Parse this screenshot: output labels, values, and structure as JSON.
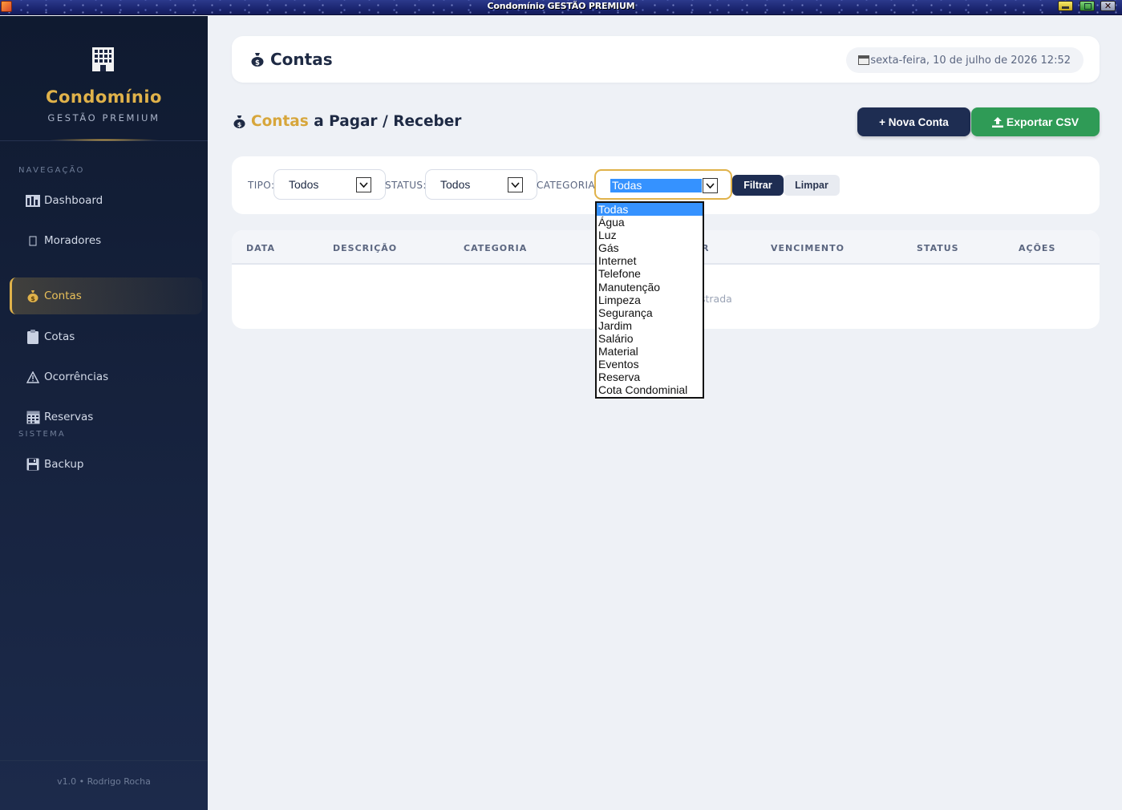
{
  "window": {
    "title": "Condomínio GESTÃO PREMIUM",
    "controls": [
      "minimize",
      "maximize",
      "close"
    ]
  },
  "sidebar": {
    "brand_name": "Condomínio",
    "brand_sub": "GESTÃO PREMIUM",
    "section_nav": "NAVEGAÇÃO",
    "section_system": "SISTEMA",
    "items": [
      {
        "label": "Dashboard",
        "icon": "chart-bars-icon"
      },
      {
        "label": "Moradores",
        "icon": "placeholder-box-icon"
      },
      {
        "label": "Contas",
        "icon": "money-bag-icon",
        "active": true
      },
      {
        "label": "Cotas",
        "icon": "clipboard-icon"
      },
      {
        "label": "Ocorrências",
        "icon": "warning-icon"
      },
      {
        "label": "Reservas",
        "icon": "calendar-icon"
      },
      {
        "label": "Backup",
        "icon": "floppy-disk-icon"
      }
    ],
    "footer": "v1.0 • Rodrigo Rocha"
  },
  "header": {
    "title": "Contas",
    "datetime": "sexta-feira, 10 de julho de 2026 12:52"
  },
  "section": {
    "title_highlight": "Contas",
    "title_rest": " a Pagar / Receber",
    "new_button": "+ Nova Conta",
    "export_button": "Exportar CSV"
  },
  "filters": {
    "tipo_label": "TIPO:",
    "tipo_value": "Todos",
    "status_label": "STATUS:",
    "status_value": "Todos",
    "categoria_label": "CATEGORIA:",
    "categoria_value": "Todas",
    "filter_button": "Filtrar",
    "clear_button": "Limpar",
    "categoria_options": [
      "Todas",
      "Água",
      "Luz",
      "Gás",
      "Internet",
      "Telefone",
      "Manutenção",
      "Limpeza",
      "Segurança",
      "Jardim",
      "Salário",
      "Material",
      "Eventos",
      "Reserva",
      "Cota Condominial"
    ]
  },
  "table": {
    "columns": [
      "DATA",
      "DESCRIÇÃO",
      "CATEGORIA",
      "VALOR",
      "VENCIMENTO",
      "STATUS",
      "AÇÕES"
    ],
    "visible_header_fragment": "R",
    "empty_fragment": "strada"
  },
  "colors": {
    "accent_gold": "#e0b24a",
    "navy": "#1e2d52",
    "green": "#2f9b56",
    "selection_blue": "#3592ff"
  }
}
